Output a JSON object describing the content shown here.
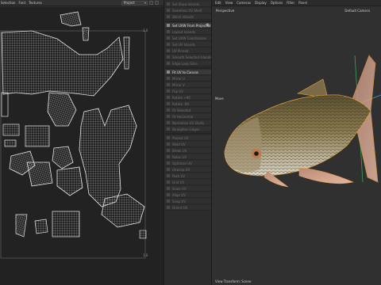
{
  "uv_editor": {
    "menu": [
      "Selection",
      "Font",
      "Textures"
    ],
    "projection_dropdown": "Project",
    "coord_top_right": "1.0",
    "coord_bottom_right": "1.0"
  },
  "tools": {
    "items": [
      {
        "label": "Set Show Islands",
        "active": false
      },
      {
        "label": "Seamless UV Shell",
        "active": false
      },
      {
        "label": "Stitch Islands",
        "active": false
      },
      {
        "label": "Set UVW From Projection",
        "active": true
      },
      {
        "label": "Layout Islands",
        "active": false
      },
      {
        "label": "Set UVW Coordinates",
        "active": false
      },
      {
        "label": "Set UV Islands",
        "active": false
      },
      {
        "label": "UV Pinned",
        "active": false
      },
      {
        "label": "Smooth Selected Islands",
        "active": false
      },
      {
        "label": "Edge Loop Slice",
        "active": false
      },
      {
        "label": "Fit UV to Canvas",
        "active": true
      },
      {
        "label": "Mirror U",
        "active": false
      },
      {
        "label": "Mirror V",
        "active": false
      },
      {
        "label": "Flip UV",
        "active": false
      },
      {
        "label": "Rotate +90",
        "active": false
      },
      {
        "label": "Rotate -90",
        "active": false
      },
      {
        "label": "Fit Selected",
        "active": false
      },
      {
        "label": "Fit Horizontal",
        "active": false
      },
      {
        "label": "Normalize UV Shells",
        "active": false
      },
      {
        "label": "Straighten Edges",
        "active": false
      },
      {
        "label": "Project UV",
        "active": false
      },
      {
        "label": "Weld UV",
        "active": false
      },
      {
        "label": "Break UV",
        "active": false
      },
      {
        "label": "Relax UV",
        "active": false
      },
      {
        "label": "Optimize UV",
        "active": false
      },
      {
        "label": "Unwrap UV",
        "active": false
      },
      {
        "label": "Pack UV",
        "active": false
      },
      {
        "label": "Grid UV",
        "active": false
      },
      {
        "label": "Scale UV",
        "active": false
      },
      {
        "label": "Align UV",
        "active": false
      },
      {
        "label": "Snap UV",
        "active": false
      },
      {
        "label": "Orient UV",
        "active": false
      }
    ]
  },
  "viewport": {
    "menu": [
      "Edit",
      "View",
      "Cameras",
      "Display",
      "Options",
      "Filter",
      "Panel"
    ],
    "perspective_label": "Perspective",
    "camera_label": "Default Camera",
    "mesh_label": "Move",
    "status": "View Transform: Scene"
  },
  "colors": {
    "viewport_bg": "#303030",
    "selection_outline": "#e0a040",
    "uv_lines": "#d8d8d8"
  }
}
